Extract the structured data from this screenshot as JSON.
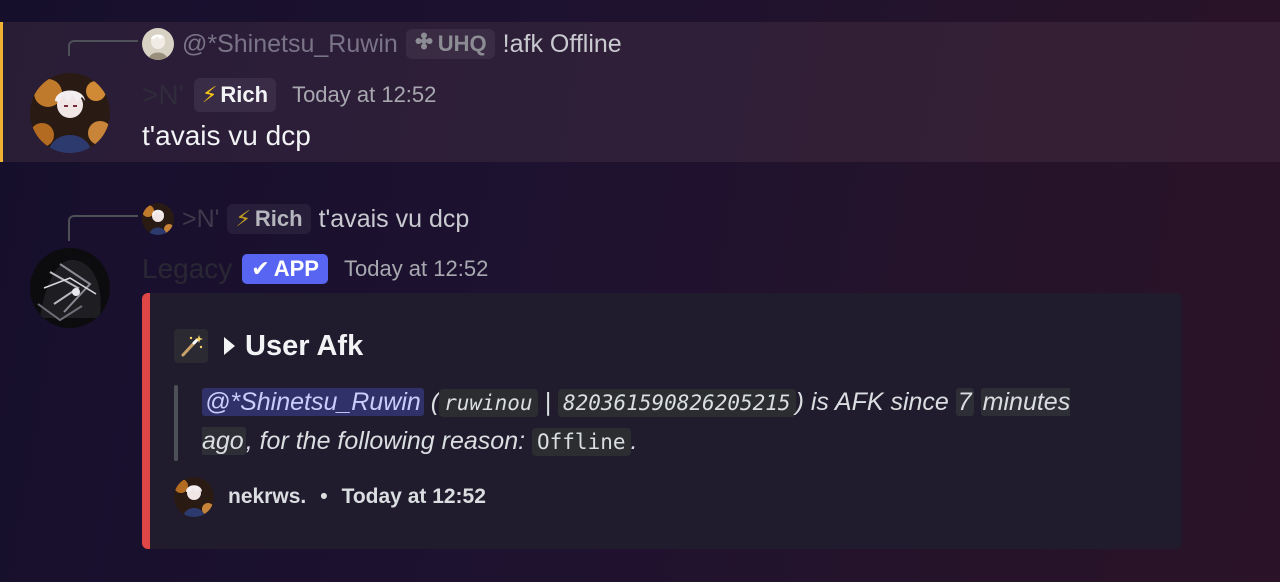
{
  "message1": {
    "reply": {
      "name": "@*Shinetsu_Ruwin",
      "tag": "UHQ",
      "text": "!afk Offline"
    },
    "author": {
      "name": ">N'",
      "tag": "Rich"
    },
    "timestamp": "Today at 12:52",
    "content": "t'avais vu dcp",
    "mention_highlight_color": "#f0b232"
  },
  "message2": {
    "reply": {
      "name": ">N'",
      "tag": "Rich",
      "text": "t'avais vu dcp"
    },
    "author": {
      "name": "Legacy",
      "badge": "APP"
    },
    "timestamp": "Today at 12:52",
    "embed": {
      "accent_color": "#e04646",
      "title": "User Afk",
      "mention": "@*Shinetsu_Ruwin",
      "open_paren": "(",
      "username_code": "ruwinou",
      "separator": "|",
      "id_code": "820361590826205215",
      "afk_since_text": ") is AFK since",
      "duration_a": "7",
      "duration_b": "minutes ago",
      "reason_text": ", for the following reason:",
      "reason_code": "Offline",
      "period": ".",
      "footer": {
        "username": "nekrws.",
        "separator": "•",
        "timestamp": "Today at 12:52"
      }
    }
  },
  "icons": {
    "bolt": "⚡",
    "check": "✔",
    "wand": "magic-wand-icon",
    "triangle": "play-triangle-icon",
    "uhq_badge": "flower-icon"
  }
}
